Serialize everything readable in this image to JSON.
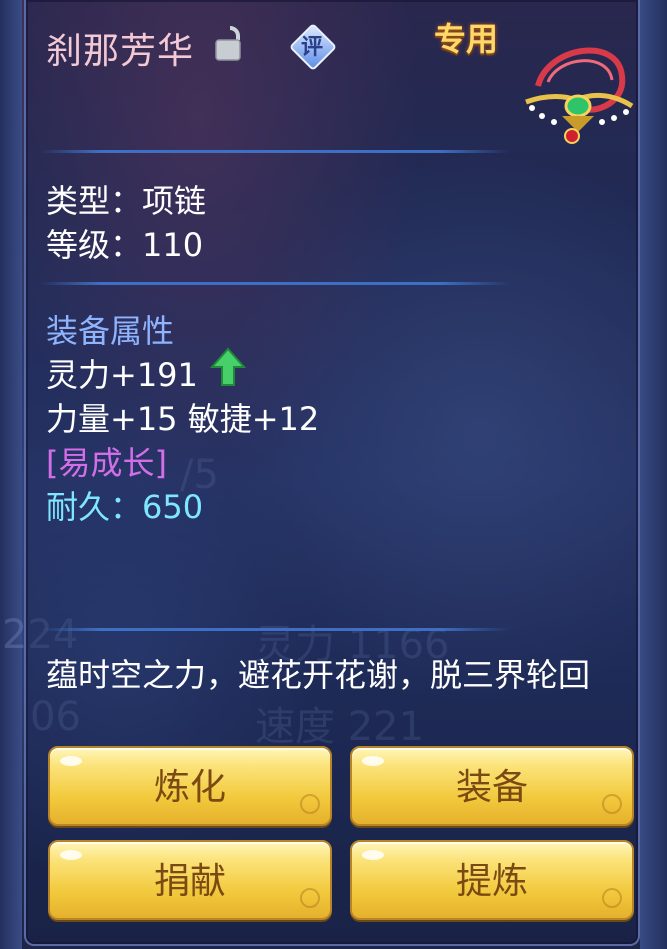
{
  "item": {
    "name": "刹那芳华",
    "rate_badge": "评",
    "exclusive_label": "专用",
    "type_line": "类型：项链",
    "level_line": "等级：110"
  },
  "attributes": {
    "section_title": "装备属性",
    "spirit": "灵力+191",
    "str_agi": "力量+15 敏捷+12",
    "growth_tag": "[易成长]",
    "durability": "耐久：650"
  },
  "description": "蕴时空之力，避花开花谢，脱三界轮回",
  "buttons": {
    "refine": "炼化",
    "equip": "装备",
    "donate": "捐献",
    "extract": "提炼"
  },
  "background_text": {
    "t1": "224",
    "t2": "灵力 1166",
    "t3": "06",
    "t4": "速度 221",
    "t5": "/5"
  },
  "icons": {
    "lock": "unlocked-padlock-icon",
    "rate": "rating-diamond-icon",
    "item": "necklace-icon",
    "increase": "green-up-arrow-icon"
  },
  "colors": {
    "name": "#f4c9d6",
    "section": "#8fb4ff",
    "growth": "#d16ee8",
    "durability": "#7ee6ff",
    "button_text": "#7a4a12"
  }
}
